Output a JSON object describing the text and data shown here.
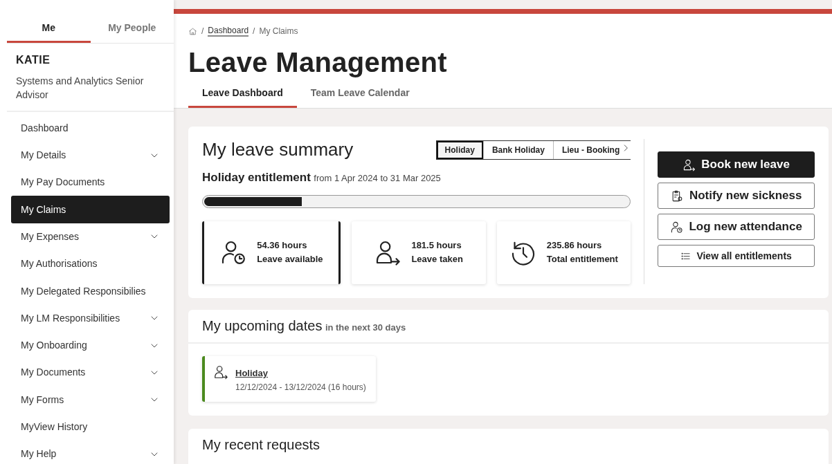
{
  "sidebar": {
    "tabs": [
      {
        "label": "Me",
        "selected": true
      },
      {
        "label": "My People",
        "selected": false
      }
    ],
    "user": {
      "name": "KATIE",
      "role": "Systems and Analytics Senior Advisor"
    },
    "items": [
      {
        "label": "Dashboard",
        "selected": false,
        "expandable": false
      },
      {
        "label": "My Details",
        "selected": false,
        "expandable": true
      },
      {
        "label": "My Pay Documents",
        "selected": false,
        "expandable": false
      },
      {
        "label": "My Claims",
        "selected": true,
        "expandable": false
      },
      {
        "label": "My Expenses",
        "selected": false,
        "expandable": true
      },
      {
        "label": "My Authorisations",
        "selected": false,
        "expandable": false
      },
      {
        "label": "My Delegated Responsibilies",
        "selected": false,
        "expandable": false
      },
      {
        "label": "My LM Responsibilities",
        "selected": false,
        "expandable": true
      },
      {
        "label": "My Onboarding",
        "selected": false,
        "expandable": true
      },
      {
        "label": "My Documents",
        "selected": false,
        "expandable": true
      },
      {
        "label": "My Forms",
        "selected": false,
        "expandable": true
      },
      {
        "label": "MyView History",
        "selected": false,
        "expandable": false
      },
      {
        "label": "My Help",
        "selected": false,
        "expandable": true
      }
    ]
  },
  "breadcrumb": [
    {
      "label": "Dashboard",
      "kind": "link",
      "separator": "/"
    },
    {
      "label": "My Claims",
      "kind": "current",
      "separator": "/"
    }
  ],
  "title": "Leave Management",
  "page_tabs": [
    {
      "label": "Leave Dashboard",
      "selected": true
    },
    {
      "label": "Team Leave Calendar",
      "selected": false
    }
  ],
  "summary": {
    "title": "My leave summary",
    "type_tabs": [
      {
        "label": "Holiday",
        "selected": true
      },
      {
        "label": "Bank Holiday",
        "selected": false
      },
      {
        "label": "Lieu - Booking",
        "selected": false
      }
    ],
    "entitlement": {
      "label": "Holiday entitlement",
      "range": "from 1 Apr 2024 to 31 Mar 2025",
      "level": 0.23
    },
    "stats": [
      {
        "value": "54.36 hours",
        "label": "Leave available",
        "selected": true
      },
      {
        "value": "181.5 hours",
        "label": "Leave taken",
        "selected": false
      },
      {
        "value": "235.86 hours",
        "label": "Total entitlement",
        "selected": false
      }
    ],
    "actions": [
      {
        "label": "Book new leave",
        "kind": "primary"
      },
      {
        "label": "Notify new sickness",
        "kind": "outline"
      },
      {
        "label": "Log new attendance",
        "kind": "outline"
      },
      {
        "label": "View all entitlements",
        "kind": "small"
      }
    ]
  },
  "upcoming": {
    "title": "My upcoming dates",
    "subtitle": "in the next 30 days",
    "entries": [
      {
        "title": "Holiday",
        "dates": "12/12/2024 - 13/12/2024 (16 hours)",
        "color": "#4b8a1e"
      }
    ]
  },
  "recent": {
    "title": "My recent requests"
  }
}
